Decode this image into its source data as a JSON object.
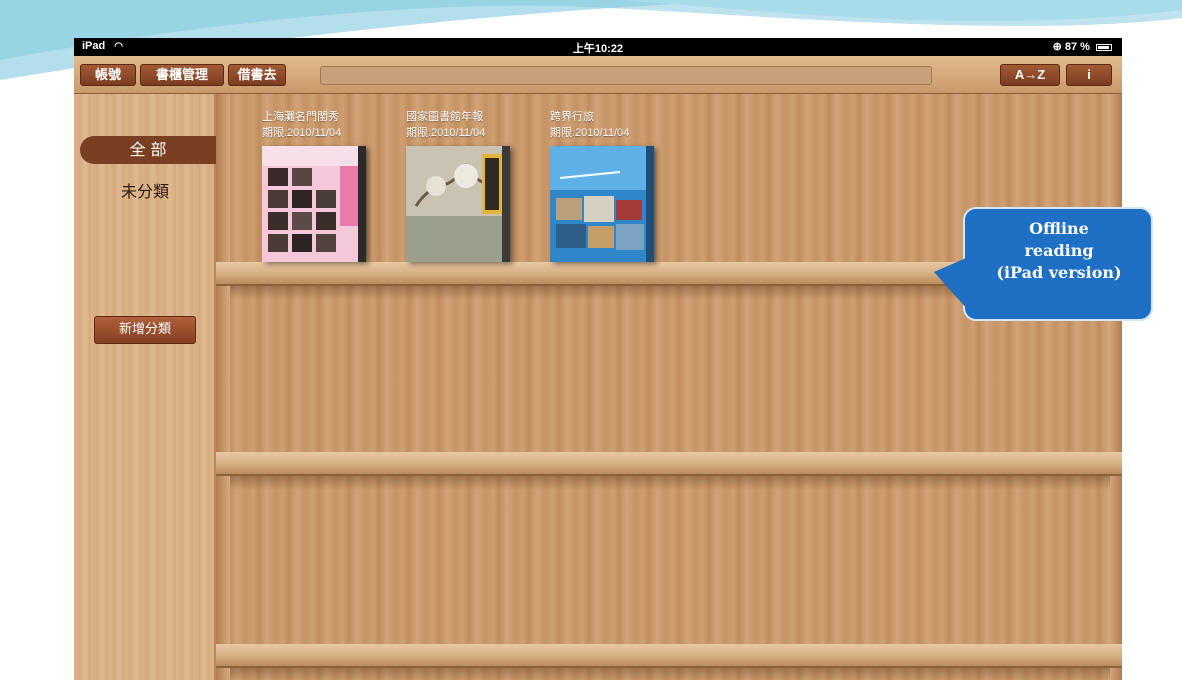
{
  "statusbar": {
    "carrier": "iPad",
    "time": "上午10:22",
    "battery": "87 %"
  },
  "toolbar": {
    "account_label": "帳號",
    "shelf_manage_label": "書櫃管理",
    "borrow_label": "借書去",
    "sort_label": "A→Z",
    "info_label": "i"
  },
  "sidebar": {
    "items": [
      {
        "label": "全 部",
        "active": true
      },
      {
        "label": "未分類",
        "active": false
      }
    ],
    "add_category_label": "新增分類"
  },
  "books": [
    {
      "title": "上海灘名門閨秀",
      "date": "期限:2010/11/04"
    },
    {
      "title": "國家圖書館年報",
      "date": "期限:2010/11/04"
    },
    {
      "title": "跨界行旅",
      "date": "期限:2010/11/04"
    }
  ],
  "callout": {
    "line1": "Offline",
    "line2": "reading",
    "line3": "(iPad version)"
  },
  "colors": {
    "toolbar_button": "#8f4a2a",
    "callout": "#1f6fc4",
    "status_bar": "#000000"
  }
}
